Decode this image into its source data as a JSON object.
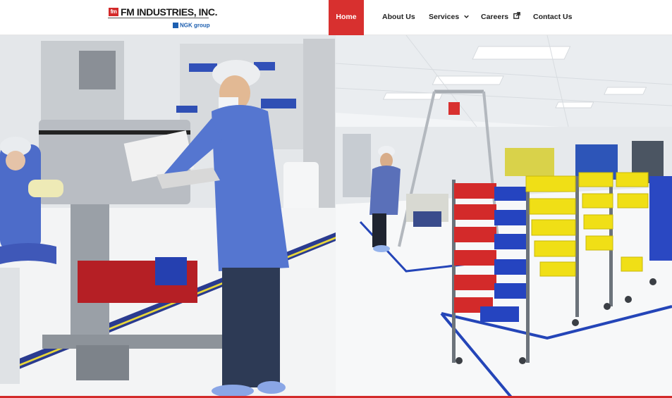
{
  "brand": {
    "logo_mark": "fm",
    "name": "FM INDUSTRIES, INC.",
    "parent": "NGK group"
  },
  "nav": {
    "items": [
      {
        "label": "Home",
        "active": true
      },
      {
        "label": "About Us"
      },
      {
        "label": "Services",
        "icon": "chevron-down-icon"
      },
      {
        "label": "Careers",
        "icon": "external-link-icon"
      },
      {
        "label": "Contact Us"
      }
    ]
  },
  "colors": {
    "accent": "#d8302f",
    "nav_text": "#222222",
    "ngk_blue": "#1d5fb0"
  }
}
